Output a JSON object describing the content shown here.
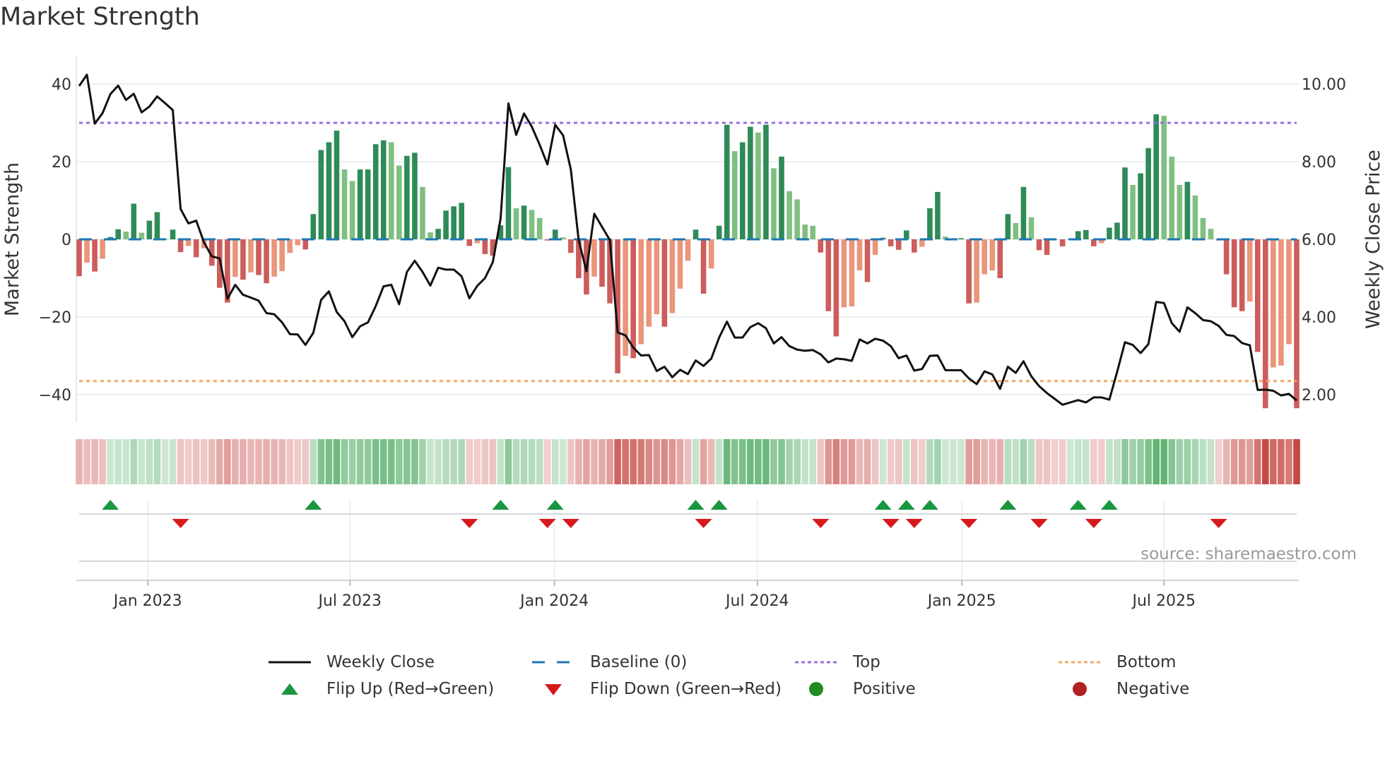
{
  "title": "Market Strength",
  "source": "source: sharemaestro.com",
  "chart_data": {
    "type": "bar",
    "title": "Market Strength",
    "ylabel": "Market Strength",
    "ylabel_right": "Weekly Close Price",
    "ylim": [
      -47,
      47
    ],
    "ylim_right": [
      1.3,
      10.7
    ],
    "yticks": [
      {
        "v": -40,
        "label": "−40"
      },
      {
        "v": -20,
        "label": "−20"
      },
      {
        "v": 0,
        "label": "0"
      },
      {
        "v": 20,
        "label": "20"
      },
      {
        "v": 40,
        "label": "40"
      }
    ],
    "yticks_right": [
      {
        "v": 2,
        "label": "2.00"
      },
      {
        "v": 4,
        "label": "4.00"
      },
      {
        "v": 6,
        "label": "6.00"
      },
      {
        "v": 8,
        "label": "8.00"
      },
      {
        "v": 10,
        "label": "10.00"
      }
    ],
    "xticks": [
      {
        "week": 8.8,
        "label": "Jan 2023"
      },
      {
        "week": 34.7,
        "label": "Jul 2023"
      },
      {
        "week": 60.9,
        "label": "Jan 2024"
      },
      {
        "week": 86.9,
        "label": "Jul 2024"
      },
      {
        "week": 113.1,
        "label": "Jan 2025"
      },
      {
        "week": 139,
        "label": "Jul 2025"
      }
    ],
    "grid": true,
    "baseline": 0,
    "top": 30,
    "bottom": -36.5,
    "strength": [
      -9.5,
      -6,
      -8.3,
      -5,
      0.6,
      2.6,
      2,
      9.2,
      1.7,
      4.8,
      7,
      0,
      2.5,
      -3.3,
      -1.7,
      -4.6,
      -2.3,
      -6.8,
      -12.5,
      -16.3,
      -9.7,
      -10.4,
      -8.5,
      -9.2,
      -11.3,
      -9.6,
      -8.2,
      -3.5,
      -1.5,
      -2.6,
      6.5,
      23,
      25,
      28,
      18,
      15,
      18,
      18,
      24.5,
      25.5,
      25,
      19,
      21.5,
      22.3,
      13.5,
      1.8,
      2.7,
      7.4,
      8.5,
      9.4,
      -1.7,
      -1,
      -3.8,
      -4.2,
      3.6,
      18.6,
      8,
      8.7,
      7.6,
      5.5,
      -0.3,
      2.5,
      0.5,
      -3.5,
      -10,
      -14.2,
      -9.6,
      -12.2,
      -16.5,
      -34.5,
      -30,
      -30.6,
      -27,
      -22.5,
      -19.3,
      -22.5,
      -19,
      -12.7,
      -5.5,
      2.5,
      -14,
      -7.5,
      3.5,
      29.5,
      22.7,
      25,
      29,
      27.5,
      29.5,
      18.3,
      21.3,
      12.4,
      10.3,
      3.8,
      3.5,
      -3.4,
      -18.5,
      -25,
      -17.5,
      -17.3,
      -8,
      -11,
      -4,
      0.4,
      -1.8,
      -2.7,
      2.3,
      -3.4,
      -1.9,
      8,
      12.2,
      0.7,
      0.3,
      0.3,
      -16.5,
      -16.3,
      -9,
      -8,
      -10,
      6.5,
      4.2,
      13.5,
      5.7,
      -2.8,
      -4,
      -0.2,
      -1.8,
      0.1,
      2.1,
      2.4,
      -1.8,
      -1,
      3,
      4.3,
      18.5,
      14,
      17,
      23.5,
      32.2,
      31.8,
      21.3,
      14,
      14.8,
      11.3,
      5.5,
      2.7,
      -0.3,
      -9,
      -17.5,
      -18.5,
      -16,
      -29,
      -43.5,
      -33,
      -32.5,
      -27,
      -43.5
    ],
    "weekly_close": [
      9.95,
      10.24,
      8.98,
      9.25,
      9.74,
      9.96,
      9.59,
      9.75,
      9.27,
      9.42,
      9.68,
      9.51,
      9.33,
      6.78,
      6.41,
      6.48,
      5.92,
      5.56,
      5.51,
      4.47,
      4.83,
      4.57,
      4.5,
      4.42,
      4.1,
      4.07,
      3.86,
      3.56,
      3.55,
      3.28,
      3.59,
      4.44,
      4.66,
      4.13,
      3.89,
      3.48,
      3.76,
      3.86,
      4.28,
      4.79,
      4.83,
      4.33,
      5.16,
      5.45,
      5.16,
      4.81,
      5.27,
      5.22,
      5.22,
      5.05,
      4.48,
      4.8,
      5.0,
      5.41,
      6.53,
      9.5,
      8.69,
      9.24,
      8.9,
      8.44,
      7.93,
      8.95,
      8.68,
      7.8,
      5.98,
      5.18,
      6.66,
      6.32,
      5.98,
      3.6,
      3.53,
      3.21,
      3.01,
      3.02,
      2.61,
      2.72,
      2.45,
      2.64,
      2.53,
      2.88,
      2.74,
      2.93,
      3.47,
      3.88,
      3.47,
      3.47,
      3.74,
      3.84,
      3.71,
      3.32,
      3.48,
      3.25,
      3.16,
      3.13,
      3.15,
      3.04,
      2.83,
      2.93,
      2.91,
      2.87,
      3.42,
      3.32,
      3.44,
      3.39,
      3.25,
      2.94,
      3.01,
      2.62,
      2.66,
      3.0,
      3.01,
      2.63,
      2.63,
      2.63,
      2.42,
      2.27,
      2.6,
      2.52,
      2.15,
      2.72,
      2.56,
      2.86,
      2.47,
      2.22,
      2.04,
      1.89,
      1.74,
      1.8,
      1.86,
      1.8,
      1.93,
      1.93,
      1.87,
      2.59,
      3.35,
      3.28,
      3.07,
      3.3,
      4.39,
      4.36,
      3.84,
      3.62,
      4.25,
      4.1,
      3.92,
      3.89,
      3.77,
      3.54,
      3.51,
      3.33,
      3.27,
      2.12,
      2.13,
      2.1,
      1.98,
      2.02,
      1.85
    ],
    "flip_up_weeks": [
      4,
      30,
      54,
      61,
      79,
      82,
      103,
      106,
      109,
      119,
      128,
      132
    ],
    "flip_down_weeks": [
      13,
      50,
      60,
      63,
      80,
      95,
      104,
      107,
      114,
      123,
      130,
      146
    ],
    "colors": {
      "strong_pos": "#2e8b57",
      "weak_pos": "#80bf80",
      "strong_neg": "#cd5c5c",
      "weak_neg": "#e9967a",
      "close": "#111111",
      "baseline": "#1f77b4",
      "top": "#9b6ee0",
      "bottom": "#f2a765",
      "flip_up": "#1a9641",
      "flip_down": "#d7191c",
      "positive": "#228b22",
      "negative": "#b22222"
    },
    "legend": {
      "placement": "bottom",
      "items": [
        {
          "key": "close",
          "label": "Weekly Close"
        },
        {
          "key": "baseline",
          "label": "Baseline (0)"
        },
        {
          "key": "top",
          "label": "Top"
        },
        {
          "key": "bottom",
          "label": "Bottom"
        },
        {
          "key": "flip_up",
          "label": "Flip Up (Red→Green)"
        },
        {
          "key": "flip_down",
          "label": "Flip Down (Green→Red)"
        },
        {
          "key": "positive",
          "label": "Positive"
        },
        {
          "key": "negative",
          "label": "Negative"
        }
      ]
    }
  }
}
